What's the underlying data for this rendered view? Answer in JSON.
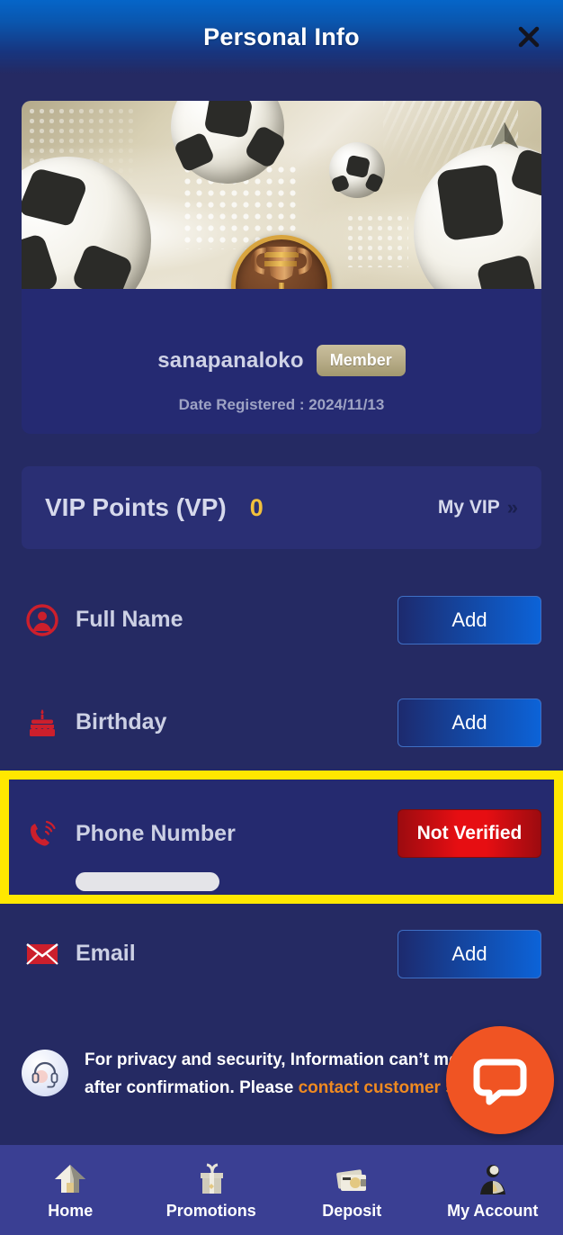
{
  "header": {
    "title": "Personal Info",
    "close_icon": "close-icon"
  },
  "profile": {
    "banner_icon": "soccer-banner",
    "brand_logo_icon": "brand-logo-icon",
    "trophy_icon": "trophy-medallion-icon",
    "username": "sanapanaloko",
    "member_badge": "Member",
    "date_registered": "Date Registered : 2024/11/13"
  },
  "vip": {
    "label": "VIP Points (VP)",
    "value": "0",
    "link_label": "My VIP",
    "chevron": "»"
  },
  "rows": {
    "fullname": {
      "label": "Full Name",
      "icon": "user-circle-icon",
      "action": "Add"
    },
    "birthday": {
      "label": "Birthday",
      "icon": "birthday-cake-icon",
      "action": "Add"
    },
    "phone": {
      "label": "Phone Number",
      "icon": "phone-ring-icon",
      "action": "Not Verified",
      "value_redacted": ""
    },
    "email": {
      "label": "Email",
      "icon": "envelope-icon",
      "action": "Add"
    }
  },
  "privacy": {
    "icon": "headset-support-icon",
    "line1": "For privacy and security, Information can’t modified",
    "line2_prefix": "after confirmation. Please ",
    "line2_link": "contact customer service"
  },
  "chat": {
    "icon": "chat-bubble-icon"
  },
  "bottom_nav": {
    "items": [
      {
        "label": "Home",
        "icon": "home-icon"
      },
      {
        "label": "Promotions",
        "icon": "gift-icon"
      },
      {
        "label": "Deposit",
        "icon": "deposit-icon"
      },
      {
        "label": "My Account",
        "icon": "account-person-icon"
      }
    ]
  },
  "colors": {
    "page_bg": "#252a63",
    "card_bg": "#252a72",
    "header_blue": "#0565c8",
    "accent_gold": "#f2c03c",
    "highlight_yellow": "#ffe800",
    "danger_red": "#e60e12",
    "chat_orange": "#f05423",
    "link_orange": "#ef8a21",
    "nav_bg": "#3a3f93"
  }
}
